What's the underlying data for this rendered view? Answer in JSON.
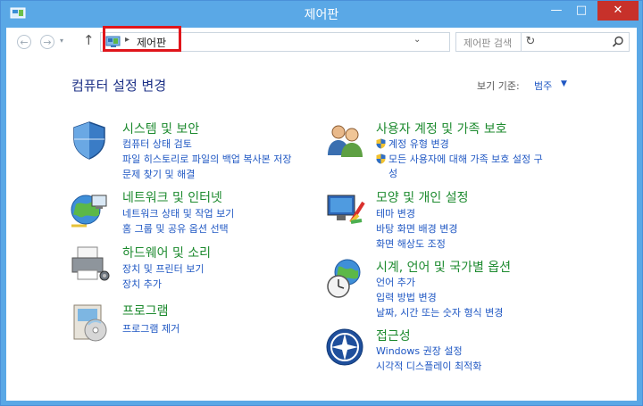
{
  "window": {
    "title": "제어판",
    "min": "—",
    "max": "□",
    "close": "✕"
  },
  "nav": {
    "back": "←",
    "forward": "→",
    "history": "▾",
    "up": "↑",
    "breadcrumb_sep": "▸",
    "address": "제어판",
    "address_dropdown": "⌄",
    "refresh": "↻",
    "search_placeholder": "제어판 검색",
    "search_icon": "⌕"
  },
  "heading": "컴퓨터 설정 변경",
  "view_by": {
    "label": "보기 기준:",
    "value": "범주",
    "caret": "▼"
  },
  "categories": {
    "system": {
      "title": "시스템 및 보안",
      "icon": "shield-icon",
      "links": [
        "컴퓨터 상태 검토",
        "파일 히스토리로 파일의 백업 복사본 저장",
        "문제 찾기 및 해결"
      ]
    },
    "user": {
      "title": "사용자 계정 및 가족 보호",
      "icon": "users-icon",
      "links": [
        "계정 유형 변경",
        "모든 사용자에 대해 가족 보호 설정 구",
        "성"
      ]
    },
    "network": {
      "title": "네트워크 및 인터넷",
      "icon": "network-icon",
      "links": [
        "네트워크 상태 및 작업 보기",
        "홈 그룹 및 공유 옵션 선택"
      ]
    },
    "appearance": {
      "title": "모양 및 개인 설정",
      "icon": "appearance-icon",
      "links": [
        "테마 변경",
        "바탕 화면 배경 변경",
        "화면 해상도 조정"
      ]
    },
    "hardware": {
      "title": "하드웨어 및 소리",
      "icon": "printer-icon",
      "links": [
        "장치 및 프린터 보기",
        "장치 추가"
      ]
    },
    "clock": {
      "title": "시계, 언어 및 국가별 옵션",
      "icon": "clock-globe-icon",
      "links": [
        "언어 추가",
        "입력 방법 변경",
        "날짜, 시간 또는 숫자 형식 변경"
      ]
    },
    "programs": {
      "title": "프로그램",
      "icon": "programs-icon",
      "links": [
        "프로그램 제거"
      ]
    },
    "ease": {
      "title": "접근성",
      "icon": "ease-of-access-icon",
      "links": [
        "Windows 권장 설정",
        "시각적 디스플레이 최적화"
      ]
    }
  },
  "colors": {
    "titlebar": "#5aa8e6",
    "link": "#1f57c3",
    "category": "#1c8a2e",
    "heading": "#1e3287",
    "highlight": "#e0151b"
  }
}
